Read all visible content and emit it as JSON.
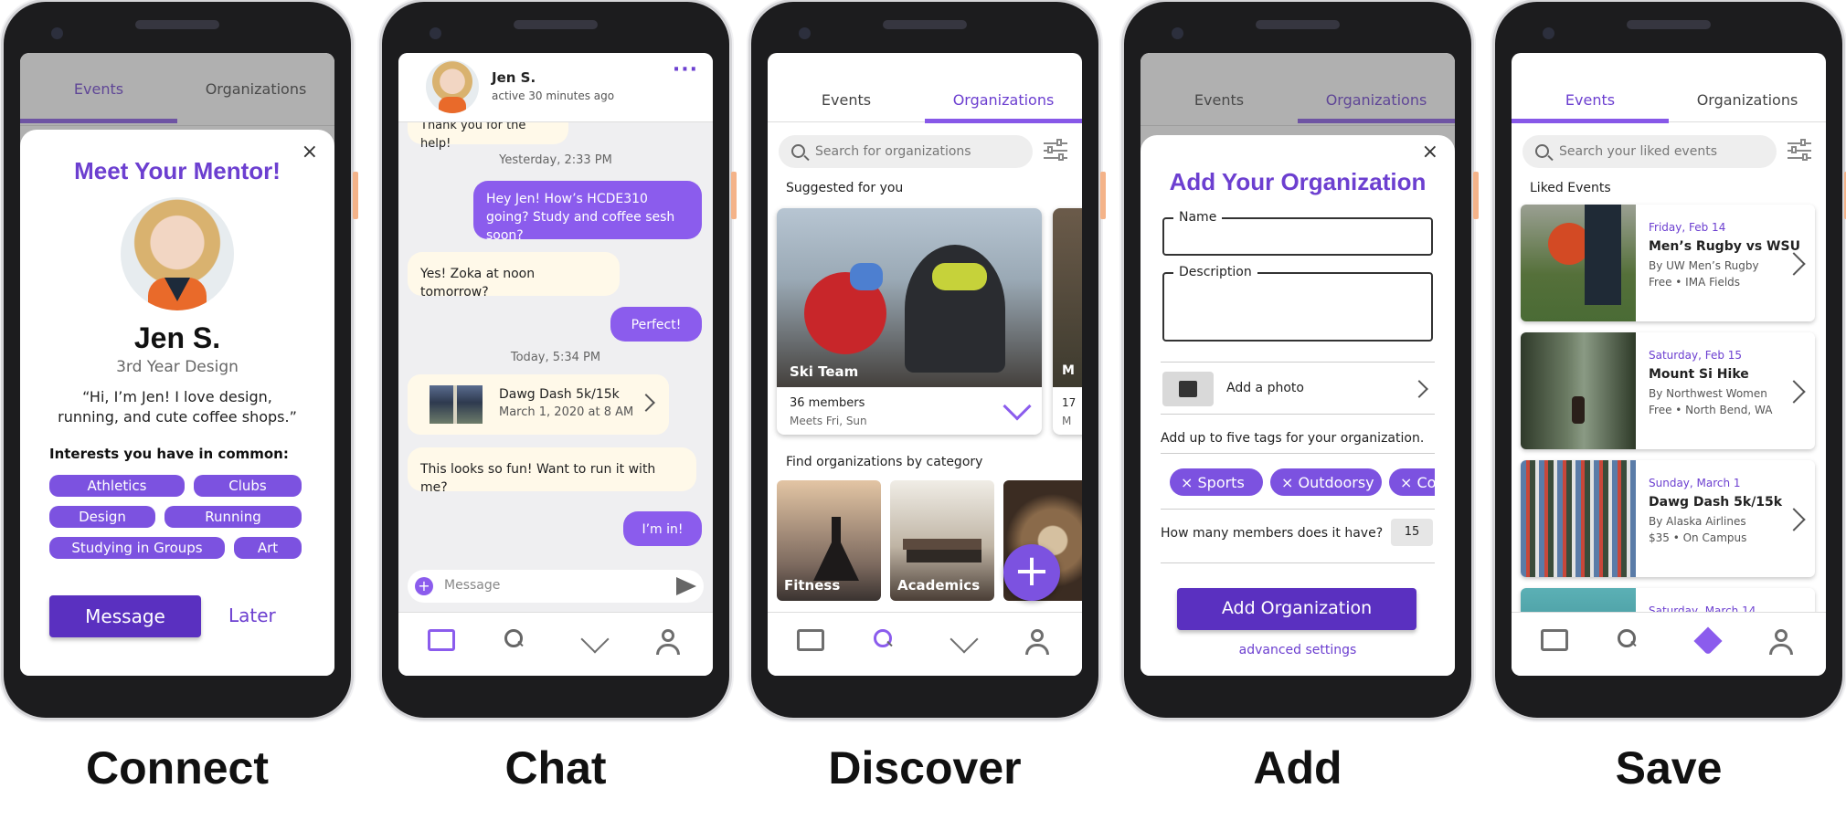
{
  "colors": {
    "accent": "#6c3fd0",
    "accent_light": "#8b5ced",
    "bubble_in": "#fff9e9"
  },
  "captions": [
    "Connect",
    "Chat",
    "Discover",
    "Add",
    "Save"
  ],
  "connect": {
    "bg_tabs": [
      "Events",
      "Organizations"
    ],
    "title": "Meet Your Mentor!",
    "name": "Jen S.",
    "subtitle": "3rd Year Design",
    "quote": "“Hi, I’m Jen! I love design, running, and cute coffee shops.”",
    "interests_heading": "Interests you have in common:",
    "interests": [
      "Athletics",
      "Clubs",
      "Design",
      "Running",
      "Studying in Groups",
      "Art"
    ],
    "message_label": "Message",
    "later_label": "Later"
  },
  "chat": {
    "name": "Jen S.",
    "status": "active 30 minutes ago",
    "partial_msg": "Thank you for the help!",
    "ts1": "Yesterday, 2:33 PM",
    "msg_out1": "Hey Jen! How’s HCDE310 going? Study and coffee sesh soon?",
    "msg_in1": "Yes! Zoka at noon tomorrow?",
    "msg_out2": "Perfect!",
    "ts2": "Today, 5:34 PM",
    "event_title": "Dawg Dash 5k/15k",
    "event_date": "March 1, 2020 at 8 AM",
    "msg_in2": "This looks so fun! Want to run it with me?",
    "msg_out3": "I’m in!",
    "input_placeholder": "Message"
  },
  "discover": {
    "tabs": [
      "Events",
      "Organizations"
    ],
    "search_placeholder": "Search for organizations",
    "suggested_heading": "Suggested for you",
    "card_name": "Ski Team",
    "card_members": "36 members",
    "card_meets": "Meets Fri, Sun",
    "peek_label": "M",
    "peek_members": "17",
    "peek_meets": "M",
    "category_heading": "Find organizations by category",
    "categories": [
      "Fitness",
      "Academics"
    ]
  },
  "add": {
    "bg_tabs": [
      "Events",
      "Organizations"
    ],
    "title": "Add Your Organization",
    "name_label": "Name",
    "desc_label": "Description",
    "photo_label": "Add a photo",
    "tags_hint": "Add up to five tags for your organization.",
    "tags": [
      "Sports",
      "Outdoorsy",
      "Co"
    ],
    "members_q": "How many members does it have?",
    "members_val": "15",
    "submit_label": "Add Organization",
    "advanced_label": "advanced settings"
  },
  "save": {
    "tabs": [
      "Events",
      "Organizations"
    ],
    "search_placeholder": "Search your liked events",
    "heading": "Liked Events",
    "events": [
      {
        "date": "Friday, Feb 14",
        "title": "Men’s Rugby vs WSU",
        "by": "By UW Men’s Rugby",
        "info": "Free • IMA Fields"
      },
      {
        "date": "Saturday, Feb 15",
        "title": "Mount Si Hike",
        "by": "By Northwest Women",
        "info": "Free • North Bend, WA"
      },
      {
        "date": "Sunday, March 1",
        "title": "Dawg Dash 5k/15k",
        "by": "By Alaska Airlines",
        "info": "$35 • On Campus"
      },
      {
        "date": "Saturday, March 14",
        "title": "",
        "by": "",
        "info": ""
      }
    ]
  }
}
